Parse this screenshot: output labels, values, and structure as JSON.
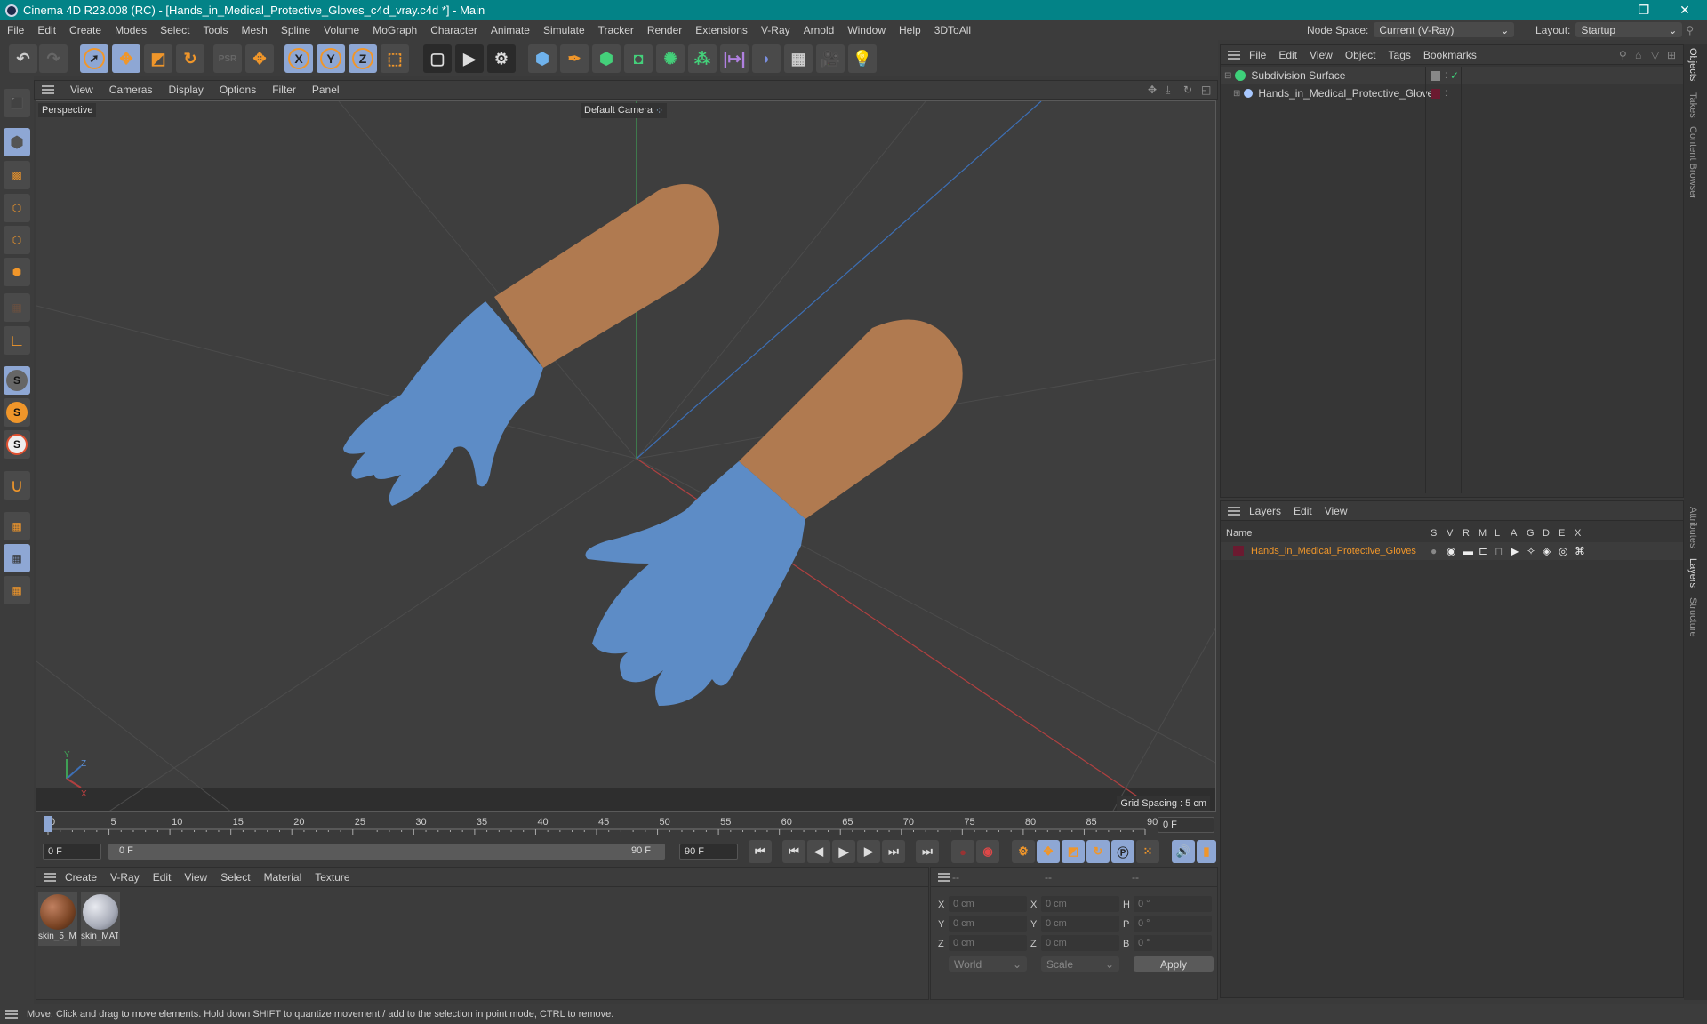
{
  "window": {
    "title": "Cinema 4D R23.008 (RC) - [Hands_in_Medical_Protective_Gloves_c4d_vray.c4d *] - Main",
    "minimize": "—",
    "restore": "❐",
    "close": "✕"
  },
  "menubar": [
    "File",
    "Edit",
    "Create",
    "Modes",
    "Select",
    "Tools",
    "Mesh",
    "Spline",
    "Volume",
    "MoGraph",
    "Character",
    "Animate",
    "Simulate",
    "Tracker",
    "Render",
    "Extensions",
    "V-Ray",
    "Arnold",
    "Window",
    "Help",
    "3DToAll"
  ],
  "header": {
    "node_space_label": "Node Space:",
    "node_space_value": "Current (V-Ray)",
    "layout_label": "Layout:",
    "layout_value": "Startup"
  },
  "toolbar": {
    "icons": [
      "undo-icon",
      "redo-icon",
      "live-selection-icon",
      "move-icon",
      "scale-icon",
      "rotate-icon",
      "psr-icon",
      "world-axis-icon",
      "x-axis-lock-icon",
      "y-axis-lock-icon",
      "z-axis-lock-icon",
      "coordinate-system-icon",
      "render-view-icon",
      "render-picture-viewer-icon",
      "render-settings-icon",
      "cube-icon",
      "pen-icon",
      "subdivision-icon",
      "extrude-icon",
      "cloner-icon",
      "array-icon",
      "symmetry-icon",
      "deformer-icon",
      "floor-icon",
      "camera-icon",
      "light-icon"
    ],
    "axis_labels": [
      "X",
      "Y",
      "Z"
    ]
  },
  "left_tools": [
    "make-editable-icon",
    "texture-mode-icon",
    "points-mode-icon",
    "edges-mode-icon",
    "polygons-mode-icon",
    "uvw-mode-icon",
    "axis-mode-icon",
    "snap-icon",
    "snap-settings-icon",
    "soft-snap-icon",
    "magnet-icon",
    "workplane-icon",
    "lock-workplane-icon",
    "align-workplane-icon"
  ],
  "viewport": {
    "menu": [
      "View",
      "Cameras",
      "Display",
      "Options",
      "Filter",
      "Panel"
    ],
    "label": "Perspective",
    "camera": "Default Camera",
    "grid_spacing": "Grid Spacing : 5 cm",
    "axis": {
      "x": "X",
      "y": "Y",
      "z": "Z"
    }
  },
  "timeline": {
    "ticks": [
      "0",
      "5",
      "10",
      "15",
      "20",
      "25",
      "30",
      "35",
      "40",
      "45",
      "50",
      "55",
      "60",
      "65",
      "70",
      "75",
      "80",
      "85",
      "90"
    ],
    "current_frame": "0 F",
    "start_frame": "0 F",
    "range_start": "0 F",
    "range_end": "90 F",
    "end_frame": "90 F",
    "current_frame_right": "0 F"
  },
  "materials": {
    "menu": [
      "Create",
      "V-Ray",
      "Edit",
      "View",
      "Select",
      "Material",
      "Texture"
    ],
    "items": [
      {
        "name": "skin_5_M",
        "color": "#8a5030"
      },
      {
        "name": "skin_MAT",
        "color": "#b8bcc4"
      }
    ]
  },
  "coordinates": {
    "headers": [
      "--",
      "--",
      "--"
    ],
    "rows": [
      {
        "pos_label": "X",
        "pos": "0 cm",
        "size_label": "X",
        "size": "0 cm",
        "rot_label": "H",
        "rot": "0 °"
      },
      {
        "pos_label": "Y",
        "pos": "0 cm",
        "size_label": "Y",
        "size": "0 cm",
        "rot_label": "P",
        "rot": "0 °"
      },
      {
        "pos_label": "Z",
        "pos": "0 cm",
        "size_label": "Z",
        "size": "0 cm",
        "rot_label": "B",
        "rot": "0 °"
      }
    ],
    "mode": "World",
    "transform": "Scale",
    "apply": "Apply"
  },
  "objects_panel": {
    "menu": [
      "File",
      "Edit",
      "View",
      "Object",
      "Tags",
      "Bookmarks"
    ],
    "items": [
      {
        "name": "Subdivision Surface",
        "level": 0
      },
      {
        "name": "Hands_in_Medical_Protective_Gloves",
        "level": 1
      }
    ]
  },
  "layers_panel": {
    "menu": [
      "Layers",
      "Edit",
      "View"
    ],
    "columns": [
      "Name",
      "S",
      "V",
      "R",
      "M",
      "L",
      "A",
      "G",
      "D",
      "E",
      "X"
    ],
    "items": [
      {
        "name": "Hands_in_Medical_Protective_Gloves",
        "color": "#6b1a30"
      }
    ]
  },
  "side_tabs": {
    "top": [
      "Objects",
      "Takes",
      "Content Browser"
    ],
    "bottom": [
      "Attributes",
      "Layers",
      "Structure"
    ]
  },
  "status": "Move: Click and drag to move elements. Hold down SHIFT to quantize movement / add to the selection in point mode, CTRL to remove.",
  "colors": {
    "titlebar": "#038387",
    "accent_orange": "#f0962a",
    "selected_blue": "#8ea7d4",
    "layer_name": "#f0962a"
  }
}
